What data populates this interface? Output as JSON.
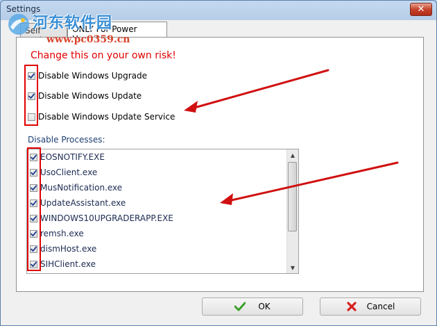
{
  "window": {
    "title": "Settings",
    "close_glyph": "✕"
  },
  "watermark": {
    "brand": "河东软件园",
    "url": "www.pc0359.cn"
  },
  "tabs": [
    {
      "label": "Self Update",
      "active": false
    },
    {
      "label": "ONLY For Power Users!",
      "active": true
    }
  ],
  "panel": {
    "warning": "Change this on your own risk!",
    "options": [
      {
        "label": "Disable Windows Upgrade",
        "checked": true
      },
      {
        "label": "Disable Windows Update",
        "checked": true
      },
      {
        "label": "Disable Windows Update Service",
        "checked": false
      }
    ],
    "processes_label": "Disable Processes:",
    "processes": [
      {
        "label": "EOSNOTIFY.EXE",
        "checked": true
      },
      {
        "label": "UsoClient.exe",
        "checked": true
      },
      {
        "label": "MusNotification.exe",
        "checked": true
      },
      {
        "label": "UpdateAssistant.exe",
        "checked": true
      },
      {
        "label": "WINDOWS10UPGRADERAPP.EXE",
        "checked": true
      },
      {
        "label": "remsh.exe",
        "checked": true
      },
      {
        "label": "dismHost.exe",
        "checked": true
      },
      {
        "label": "SIHClient.exe",
        "checked": true
      }
    ]
  },
  "buttons": {
    "ok": "OK",
    "cancel": "Cancel"
  },
  "colors": {
    "warning": "#e00000",
    "highlight": "#e00000",
    "arrow": "#d01010",
    "ok_icon": "#3aa02a",
    "cancel_icon": "#d62020"
  },
  "icons": {
    "ok": "check-icon",
    "cancel": "x-icon",
    "scroll_up": "triangle-up-icon",
    "scroll_down": "triangle-down-icon"
  }
}
